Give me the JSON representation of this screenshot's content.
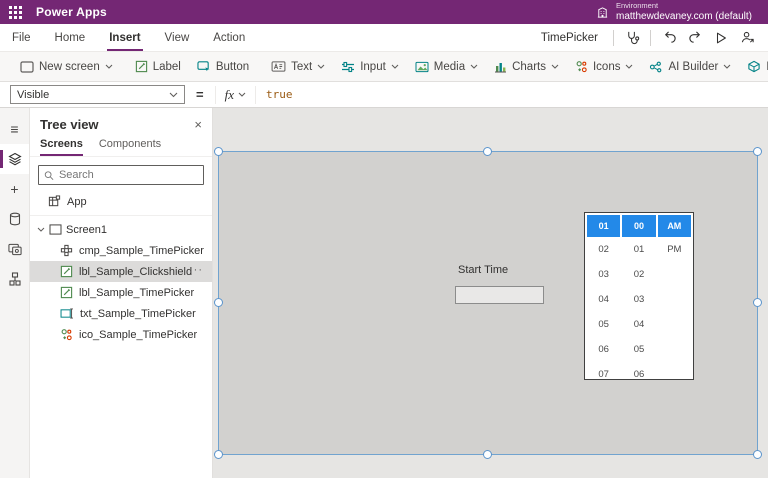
{
  "header": {
    "app_title": "Power Apps",
    "environment_label": "Environment",
    "environment_name": "matthewdevaney.com (default)"
  },
  "menubar": {
    "items": [
      "File",
      "Home",
      "Insert",
      "View",
      "Action"
    ],
    "active_item": "Insert",
    "app_name": "TimePicker"
  },
  "ribbon": {
    "items": [
      {
        "label": "New screen",
        "dropdown": true
      },
      {
        "label": "Label",
        "dropdown": false
      },
      {
        "label": "Button",
        "dropdown": false
      },
      {
        "label": "Text",
        "dropdown": true
      },
      {
        "label": "Input",
        "dropdown": true
      },
      {
        "label": "Media",
        "dropdown": true
      },
      {
        "label": "Charts",
        "dropdown": true
      },
      {
        "label": "Icons",
        "dropdown": true
      },
      {
        "label": "AI Builder",
        "dropdown": true
      },
      {
        "label": "Mixed Reality",
        "dropdown": true
      }
    ]
  },
  "formula_bar": {
    "property": "Visible",
    "equals": "=",
    "fx": "fx",
    "formula": "true"
  },
  "tree_view": {
    "title": "Tree view",
    "tabs": [
      "Screens",
      "Components"
    ],
    "active_tab": "Screens",
    "search_placeholder": "Search",
    "app_label": "App",
    "screen_label": "Screen1",
    "items": [
      "cmp_Sample_TimePicker",
      "lbl_Sample_Clickshield",
      "lbl_Sample_TimePicker",
      "txt_Sample_TimePicker",
      "ico_Sample_TimePicker"
    ],
    "selected_item": "lbl_Sample_Clickshield"
  },
  "canvas": {
    "start_time_label": "Start Time",
    "time_input_value": "",
    "time_picker": {
      "hours": [
        "01",
        "02",
        "03",
        "04",
        "05",
        "06",
        "07"
      ],
      "minutes": [
        "00",
        "01",
        "02",
        "03",
        "04",
        "05",
        "06"
      ],
      "meridiem": [
        "AM",
        "PM"
      ],
      "selected": {
        "hour": "01",
        "minute": "00",
        "meridiem": "AM"
      }
    }
  },
  "icons": {
    "hamburger": "≡",
    "plus": "+",
    "close": "×",
    "ellipsis": "···"
  },
  "colors": {
    "brand_purple": "#742774",
    "selection_blue": "#71a3cf",
    "timepicker_selected_blue": "#2389e8",
    "formula_keyword_orange": "#9a5b13",
    "screen_fill_gray": "#d2d1cf"
  }
}
